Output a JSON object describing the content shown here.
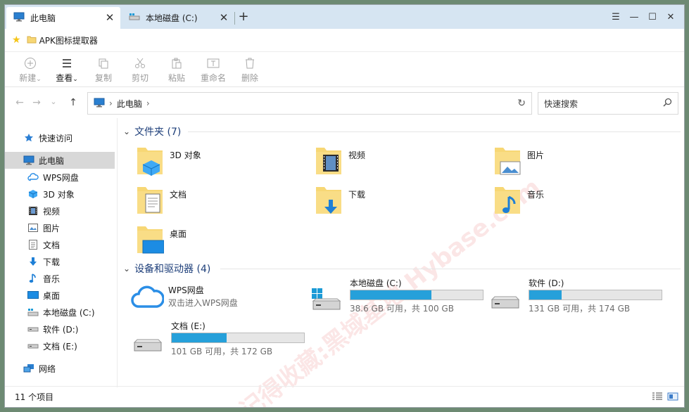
{
  "tabs": [
    {
      "label": "此电脑",
      "icon": "computer-icon",
      "active": true
    },
    {
      "label": "本地磁盘 (C:)",
      "icon": "drive-icon",
      "active": false
    }
  ],
  "tab_close_glyph": "✕",
  "new_tab_glyph": "+",
  "window_controls": {
    "menu": "☰",
    "minimize": "—",
    "maximize": "☐",
    "close": "✕"
  },
  "favorites": {
    "star": "★",
    "items": [
      {
        "label": "APK图标提取器",
        "icon": "folder-icon"
      }
    ]
  },
  "ribbon": [
    {
      "label": "新建",
      "icon": "new-icon",
      "enabled": false,
      "dropdown": true
    },
    {
      "label": "查看",
      "icon": "view-icon",
      "enabled": true,
      "dropdown": true
    },
    {
      "label": "复制",
      "icon": "copy-icon",
      "enabled": false
    },
    {
      "label": "剪切",
      "icon": "cut-icon",
      "enabled": false
    },
    {
      "label": "粘贴",
      "icon": "paste-icon",
      "enabled": false
    },
    {
      "label": "重命名",
      "icon": "rename-icon",
      "enabled": false
    },
    {
      "label": "删除",
      "icon": "delete-icon",
      "enabled": false
    }
  ],
  "nav": {
    "back": "←",
    "forward": "→",
    "recent": "⌄",
    "up": "↑",
    "address": {
      "crumb": "此电脑",
      "sep": "›",
      "end_sep": "›",
      "icon": "computer-icon"
    },
    "refresh": "↻",
    "search_placeholder": "快速搜索",
    "search_icon": "⌕"
  },
  "sidebar": [
    {
      "label": "快速访问",
      "icon": "star-icon"
    },
    {
      "label": "此电脑",
      "icon": "computer-icon",
      "selected": true
    },
    {
      "label": "WPS网盘",
      "icon": "cloud-icon"
    },
    {
      "label": "3D 对象",
      "icon": "cube-icon"
    },
    {
      "label": "视频",
      "icon": "video-icon"
    },
    {
      "label": "图片",
      "icon": "picture-icon"
    },
    {
      "label": "文档",
      "icon": "document-icon"
    },
    {
      "label": "下载",
      "icon": "download-icon"
    },
    {
      "label": "音乐",
      "icon": "music-icon"
    },
    {
      "label": "桌面",
      "icon": "desktop-icon"
    },
    {
      "label": "本地磁盘 (C:)",
      "icon": "drive-icon"
    },
    {
      "label": "软件 (D:)",
      "icon": "drive-icon"
    },
    {
      "label": "文档 (E:)",
      "icon": "drive-icon"
    },
    {
      "label": "网络",
      "icon": "network-icon"
    }
  ],
  "groups": {
    "folders": {
      "title": "文件夹 (7)",
      "items": [
        {
          "label": "3D 对象",
          "icon": "folder-3d-icon"
        },
        {
          "label": "视频",
          "icon": "folder-video-icon"
        },
        {
          "label": "图片",
          "icon": "folder-pictures-icon"
        },
        {
          "label": "文档",
          "icon": "folder-documents-icon"
        },
        {
          "label": "下载",
          "icon": "folder-downloads-icon"
        },
        {
          "label": "音乐",
          "icon": "folder-music-icon"
        },
        {
          "label": "桌面",
          "icon": "folder-desktop-icon"
        }
      ]
    },
    "drives": {
      "title": "设备和驱动器 (4)",
      "items": [
        {
          "label": "WPS网盘",
          "sub": "双击进入WPS网盘",
          "icon": "cloud-drive-icon"
        },
        {
          "label": "本地磁盘 (C:)",
          "info": "38.6 GB 可用，共 100 GB",
          "used_fraction": 0.614,
          "icon": "system-drive-icon"
        },
        {
          "label": "软件 (D:)",
          "info": "131 GB 可用，共 174 GB",
          "used_fraction": 0.247,
          "icon": "hard-drive-icon"
        },
        {
          "label": "文档 (E:)",
          "info": "101 GB 可用，共 172 GB",
          "used_fraction": 0.413,
          "icon": "hard-drive-icon"
        }
      ]
    }
  },
  "status": {
    "count": "11 个项目"
  },
  "watermark": "记得收藏:黑域基地 Hybase.com",
  "colors": {
    "accent": "#26a0da",
    "tabbar": "#d6e5f2",
    "folder": "#f7d775",
    "selection": "#d8d8d8"
  }
}
